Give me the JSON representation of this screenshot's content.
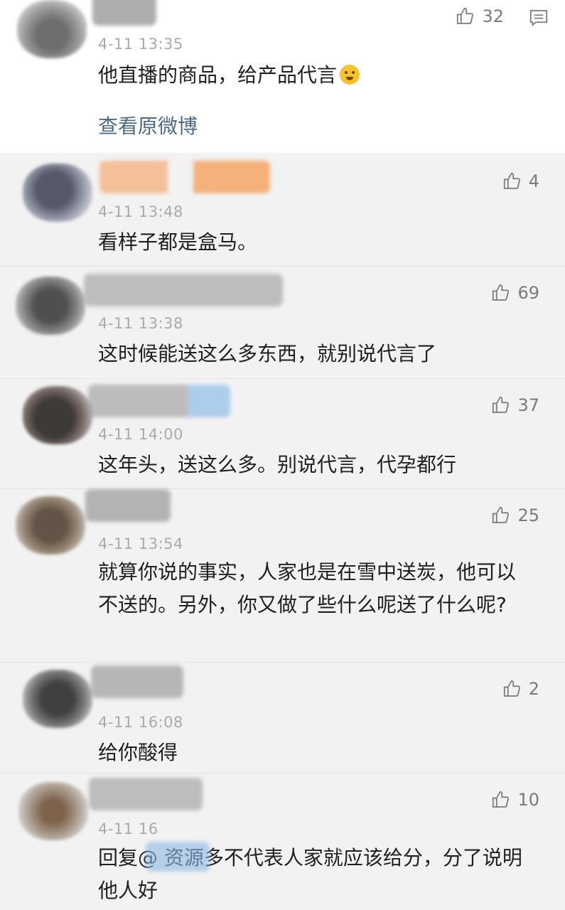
{
  "top_comment": {
    "time": "4-11 13:35",
    "text": "他直播的商品，给产品代言",
    "likes": "32",
    "view_original": "查看原微博",
    "emoji_icon": "shushing-face-icon"
  },
  "replies": [
    {
      "time": "4-11 13:48",
      "text": "看样子都是盒马。",
      "likes": "4"
    },
    {
      "time": "4-11 13:38",
      "text": "这时候能送这么多东西，就别说代言了",
      "likes": "69"
    },
    {
      "time": "4-11 14:00",
      "text": "这年头，送这么多。别说代言，代孕都行",
      "likes": "37"
    },
    {
      "time": "4-11 13:54",
      "text": "就算你说的事实，人家也是在雪中送炭，他可以不送的。另外，你又做了些什么呢送了什么呢?",
      "likes": "25"
    },
    {
      "time": "4-11 16:08",
      "text": "给你酸得",
      "likes": "2"
    },
    {
      "time": "4-11 16",
      "text": "回复@ 资源多不代表人家就应该给分，分了说明他人好",
      "likes": "10"
    }
  ],
  "icons": {
    "like": "thumbs-up-icon",
    "comment": "comment-icon"
  },
  "colors": {
    "link": "#4f6b84",
    "time": "#aaaaaa",
    "background": "#f2f2f2"
  }
}
